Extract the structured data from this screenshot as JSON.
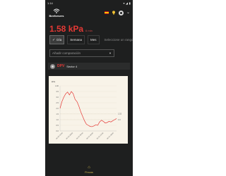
{
  "status_bar": {
    "time": "1:14",
    "right": "▾ ◢ ▮"
  },
  "header": {
    "brand": "Beeforsers"
  },
  "reading": {
    "value": "1.58 kPa",
    "ago": "6 min"
  },
  "tabs": [
    {
      "label": "Día",
      "active": true
    },
    {
      "label": "Semana",
      "active": false
    },
    {
      "label": "Mes",
      "active": false
    }
  ],
  "tabs_input_placeholder": "Seleccione un rango",
  "compare_placeholder": "Añadir comparación",
  "card": {
    "metric": "DPV",
    "sector": "Sector 4"
  },
  "footer": {
    "label": "Fincas"
  },
  "chart_data": {
    "type": "line",
    "unit_label": "kPa",
    "y_ticks": [
      "4.00",
      "3.5",
      "3.0",
      "2.5",
      "2.0",
      "1.5",
      "1.0",
      "0.5",
      "0.0"
    ],
    "ylim": [
      0,
      4
    ],
    "x_ticks": [
      "06-20 12:00",
      "06-20 18:00",
      "06-21 00:00",
      "06-21 06:00",
      "06-21 12:00",
      "06-21 18:00"
    ],
    "right_labels": [
      {
        "text": "1.52",
        "y": 1.52
      },
      {
        "text": "1.0",
        "y": 1.0
      }
    ],
    "series": [
      {
        "color": "#e53935",
        "x": [
          0,
          1,
          2,
          3,
          4,
          5,
          6,
          7,
          8,
          9,
          10,
          11,
          12,
          13,
          14,
          15,
          16,
          17,
          18,
          19,
          20,
          21,
          22,
          23,
          24,
          25,
          26,
          27,
          28,
          29,
          30
        ],
        "y": [
          2.0,
          2.6,
          3.0,
          3.3,
          3.45,
          3.2,
          3.5,
          3.3,
          2.8,
          2.6,
          2.2,
          1.7,
          1.3,
          0.9,
          0.6,
          0.5,
          0.4,
          0.38,
          0.45,
          0.55,
          0.5,
          0.8,
          0.95,
          0.85,
          0.7,
          0.75,
          0.85,
          0.8,
          0.9,
          1.0,
          1.1
        ]
      }
    ]
  }
}
